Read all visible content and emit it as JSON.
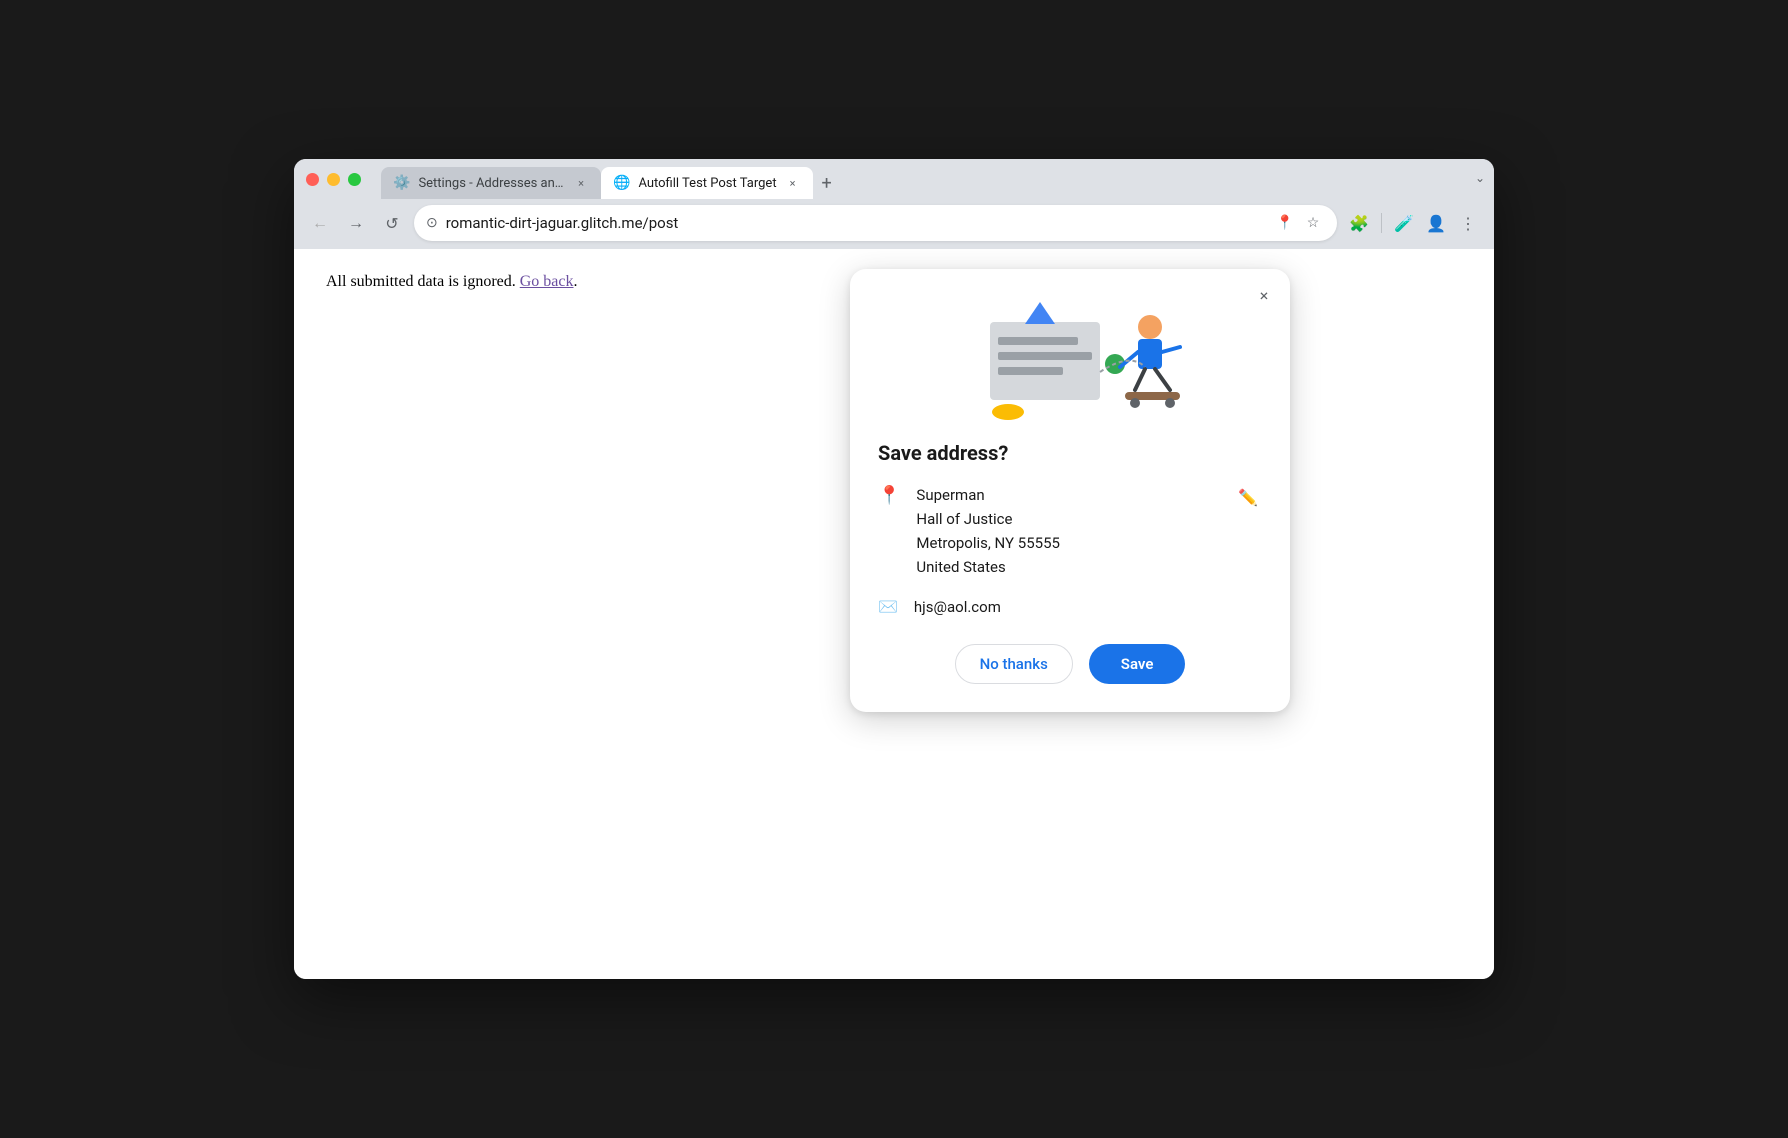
{
  "browser": {
    "tabs": [
      {
        "id": "settings-tab",
        "icon": "⚙️",
        "title": "Settings - Addresses and mo",
        "active": false
      },
      {
        "id": "autofill-tab",
        "icon": "🌐",
        "title": "Autofill Test Post Target",
        "active": true
      }
    ],
    "new_tab_label": "+",
    "expand_label": "⌄",
    "url": "romantic-dirt-jaguar.glitch.me/post",
    "nav": {
      "back": "←",
      "forward": "→",
      "reload": "↺"
    },
    "toolbar": {
      "location_icon": "📍",
      "star_icon": "☆",
      "extension_icon": "🧩",
      "lab_icon": "🧪",
      "profile_icon": "👤",
      "menu_icon": "⋮"
    }
  },
  "page": {
    "content": "All submitted data is ignored.",
    "go_back_link": "Go back"
  },
  "popup": {
    "title": "Save address?",
    "close_label": "×",
    "address": {
      "name": "Superman",
      "line1": "Hall of Justice",
      "line2": "Metropolis, NY 55555",
      "country": "United States"
    },
    "email": "hjs@aol.com",
    "buttons": {
      "no_thanks": "No thanks",
      "save": "Save"
    }
  }
}
